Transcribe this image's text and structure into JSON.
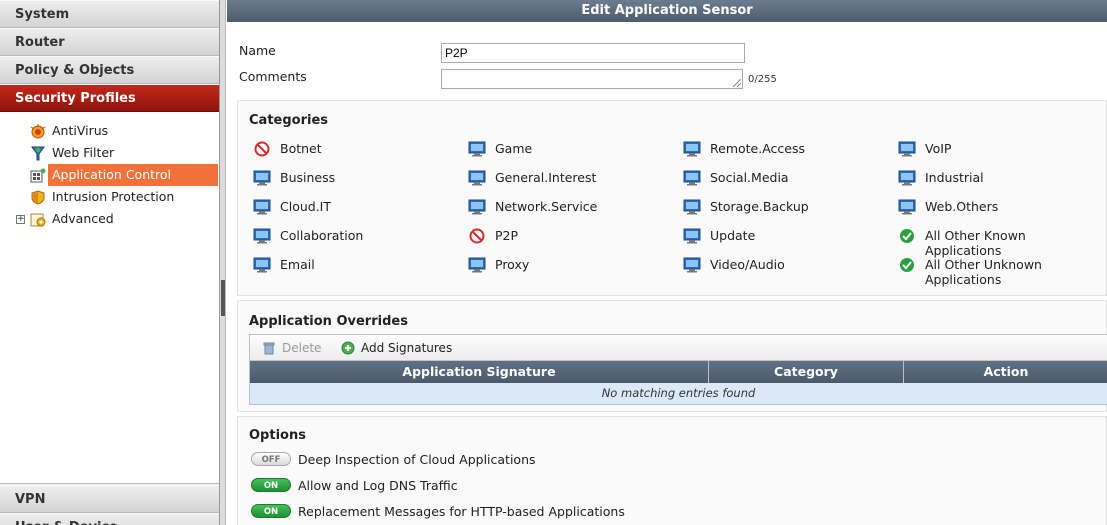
{
  "sidebar": {
    "top_items": [
      {
        "label": "System"
      },
      {
        "label": "Router"
      },
      {
        "label": "Policy & Objects"
      },
      {
        "label": "Security Profiles",
        "active": true
      }
    ],
    "sub_items": [
      {
        "label": "AntiVirus",
        "icon": "antivirus-icon"
      },
      {
        "label": "Web Filter",
        "icon": "web-filter-icon"
      },
      {
        "label": "Application Control",
        "icon": "application-control-icon",
        "active": true
      },
      {
        "label": "Intrusion Protection",
        "icon": "shield-icon"
      },
      {
        "label": "Advanced",
        "icon": "advanced-icon",
        "expandable": true,
        "expander": "+"
      }
    ],
    "bottom_items": [
      {
        "label": "VPN"
      },
      {
        "label": "User & Device"
      }
    ]
  },
  "main": {
    "title": "Edit Application Sensor",
    "name_label": "Name",
    "name_value": "P2P",
    "comments_label": "Comments",
    "comments_value": "",
    "comments_counter": "0/255",
    "categories_title": "Categories",
    "categories": [
      {
        "label": "Botnet",
        "status": "block"
      },
      {
        "label": "Business",
        "status": "monitor"
      },
      {
        "label": "Cloud.IT",
        "status": "monitor"
      },
      {
        "label": "Collaboration",
        "status": "monitor"
      },
      {
        "label": "Email",
        "status": "monitor"
      },
      {
        "label": "Game",
        "status": "monitor"
      },
      {
        "label": "General.Interest",
        "status": "monitor"
      },
      {
        "label": "Network.Service",
        "status": "monitor"
      },
      {
        "label": "P2P",
        "status": "block"
      },
      {
        "label": "Proxy",
        "status": "monitor"
      },
      {
        "label": "Remote.Access",
        "status": "monitor"
      },
      {
        "label": "Social.Media",
        "status": "monitor"
      },
      {
        "label": "Storage.Backup",
        "status": "monitor"
      },
      {
        "label": "Update",
        "status": "monitor"
      },
      {
        "label": "Video/Audio",
        "status": "monitor"
      },
      {
        "label": "VoIP",
        "status": "monitor"
      },
      {
        "label": "Industrial",
        "status": "monitor"
      },
      {
        "label": "Web.Others",
        "status": "monitor"
      },
      {
        "label": "All Other Known Applications",
        "status": "allow"
      },
      {
        "label": "All Other Unknown Applications",
        "status": "allow"
      }
    ],
    "overrides_title": "Application Overrides",
    "toolbar": {
      "delete_label": "Delete",
      "add_label": "Add Signatures"
    },
    "columns": [
      "Application Signature",
      "Category",
      "Action"
    ],
    "empty_message": "No matching entries found",
    "options_title": "Options",
    "options": [
      {
        "label": "Deep Inspection of Cloud Applications",
        "state": "OFF"
      },
      {
        "label": "Allow and Log DNS Traffic",
        "state": "ON"
      },
      {
        "label": "Replacement Messages for HTTP-based Applications",
        "state": "ON"
      }
    ]
  },
  "colors": {
    "active_nav": "#b01f14",
    "active_subitem": "#f2703a",
    "title_bar": "#5d6b7d",
    "toggle_on": "#2aa03f",
    "block": "#d92b2b",
    "allow": "#2aa03f"
  }
}
